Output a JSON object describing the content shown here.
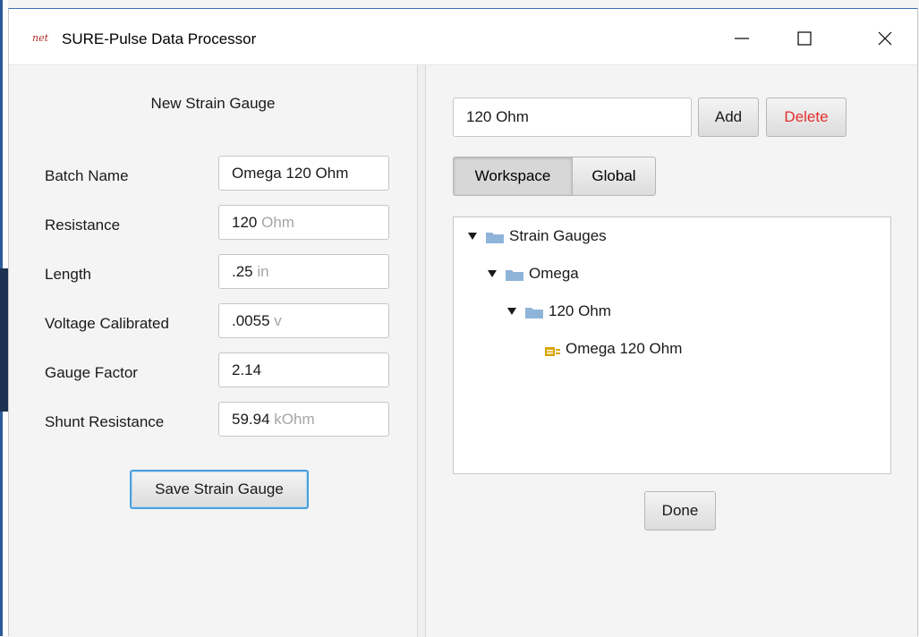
{
  "window": {
    "logo_text": "net",
    "title": "SURE-Pulse Data Processor"
  },
  "left": {
    "form_title": "New Strain Gauge",
    "fields": [
      {
        "label": "Batch Name",
        "value": "Omega 120 Ohm",
        "unit": ""
      },
      {
        "label": "Resistance",
        "value": "120",
        "unit": "Ohm"
      },
      {
        "label": "Length",
        "value": ".25",
        "unit": "in"
      },
      {
        "label": "Voltage Calibrated",
        "value": ".0055",
        "unit": "v"
      },
      {
        "label": "Gauge Factor",
        "value": "2.14",
        "unit": ""
      },
      {
        "label": "Shunt Resistance",
        "value": "59.94",
        "unit": "kOhm"
      }
    ],
    "save_label": "Save Strain Gauge"
  },
  "right": {
    "name_value": "120 Ohm",
    "add_label": "Add",
    "delete_label": "Delete",
    "tabs": [
      {
        "label": "Workspace",
        "selected": true
      },
      {
        "label": "Global",
        "selected": false
      }
    ],
    "tree": {
      "root": "Strain Gauges",
      "level1": "Omega",
      "level2": "120 Ohm",
      "leaf": "Omega 120 Ohm"
    },
    "done_label": "Done"
  },
  "colors": {
    "delete_text": "#e62e2e",
    "folder": "#8fb4d9",
    "gauge_icon": "#d9a400",
    "focus": "#4a9fdc"
  },
  "icons": {
    "folder": "folder-icon",
    "gauge": "strain-gauge-icon",
    "expand": "triangle-down-icon"
  }
}
